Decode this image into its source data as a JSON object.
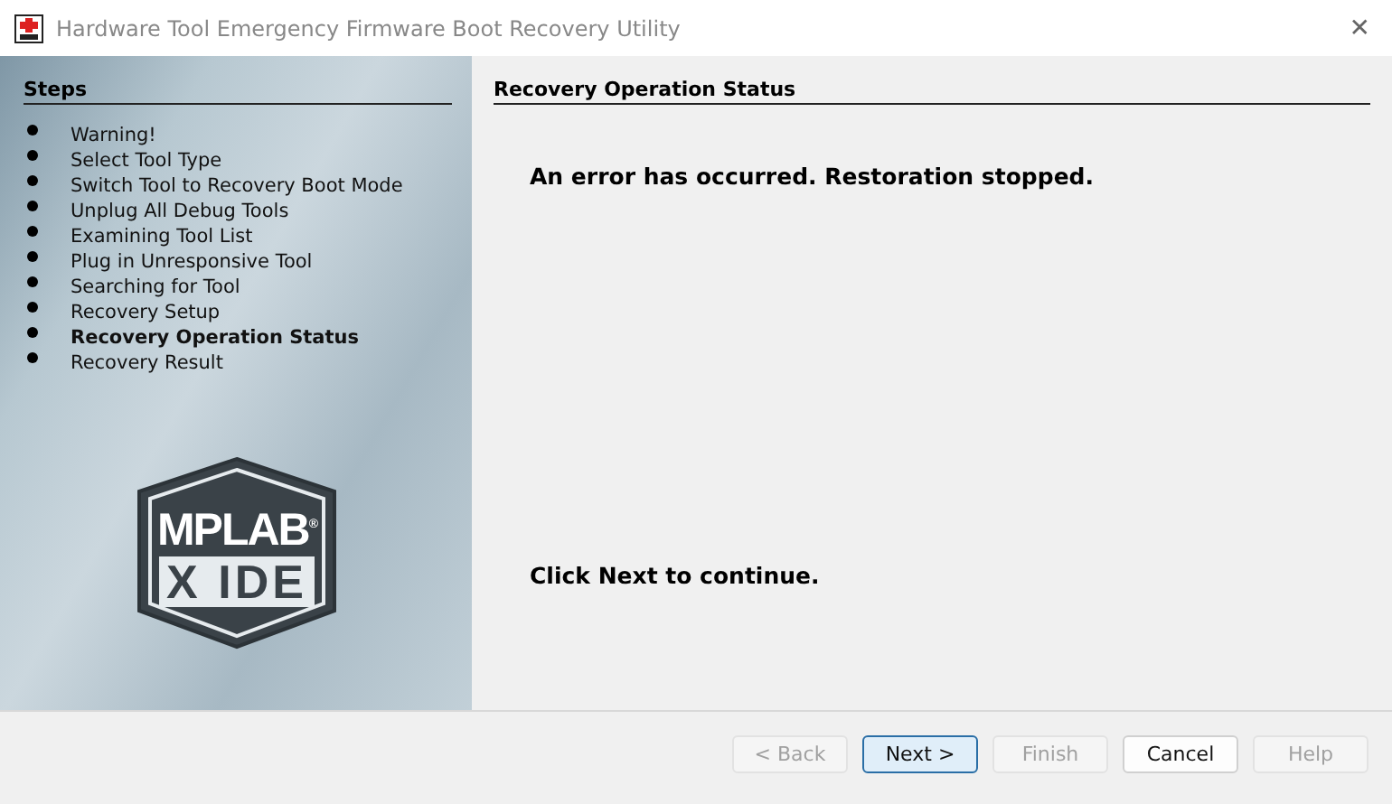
{
  "window": {
    "title": "Hardware Tool Emergency Firmware Boot Recovery Utility",
    "close": "✕"
  },
  "steps": {
    "title": "Steps",
    "items": [
      {
        "label": "Warning!",
        "selected": false
      },
      {
        "label": "Select Tool Type",
        "selected": false
      },
      {
        "label": "Switch Tool to Recovery Boot Mode",
        "selected": false
      },
      {
        "label": "Unplug All Debug Tools",
        "selected": false
      },
      {
        "label": "Examining Tool List",
        "selected": false
      },
      {
        "label": "Plug in Unresponsive Tool",
        "selected": false
      },
      {
        "label": "Searching for Tool",
        "selected": false
      },
      {
        "label": "Recovery Setup",
        "selected": false
      },
      {
        "label": "Recovery Operation Status",
        "selected": true
      },
      {
        "label": "Recovery Result",
        "selected": false
      }
    ]
  },
  "logo": {
    "line_1": "MPLAB$^{®}$",
    "line_2": "X IDE"
  },
  "content": {
    "title": "Recovery Operation Status",
    "message": "An error has occurred. Restoration stopped.",
    "hint": "Click Next to continue."
  },
  "buttons": [
    {
      "label": "< Back",
      "disabled": true,
      "default": false
    },
    {
      "label": "Next >",
      "disabled": false,
      "default": true
    },
    {
      "label": "Finish",
      "disabled": true,
      "default": false
    },
    {
      "label": "Cancel",
      "disabled": false,
      "default": false
    },
    {
      "label": "Help",
      "disabled": true,
      "default": false
    }
  ]
}
